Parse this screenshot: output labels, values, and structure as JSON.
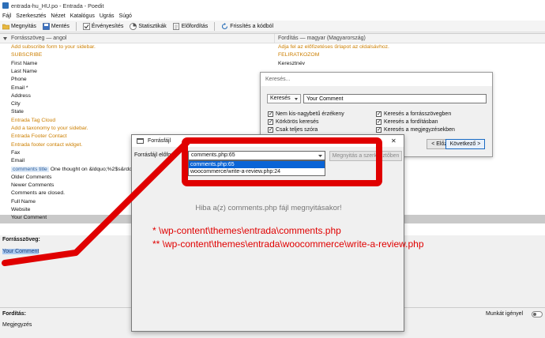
{
  "window": {
    "title": "entrada-hu_HU.po - Entrada - Poedit"
  },
  "menu": [
    "Fájl",
    "Szerkesztés",
    "Nézet",
    "Katalógus",
    "Ugrás",
    "Súgó"
  ],
  "toolbar": {
    "open": "Megnyitás",
    "save": "Mentés",
    "validate": "Érvényesítés",
    "stats": "Statisztikák",
    "pretranslate": "Előfordítás",
    "update": "Frissítés a kódból"
  },
  "columns": {
    "source": "Forrásszöveg — angol",
    "translation": "Fordítás — magyar (Magyarország)"
  },
  "rows": [
    {
      "source": "Add subscribe form to your sidebar.",
      "translation": "Adja fel az előfizetéses űrlapot az oldalsávhoz.",
      "style": "orange"
    },
    {
      "source": "SUBSCRIBE",
      "translation": "FELIRATKOZOM",
      "style": "orange"
    },
    {
      "source": "First Name",
      "translation": "Keresztnév",
      "style": ""
    },
    {
      "source": "Last Name",
      "translation": "",
      "style": ""
    },
    {
      "source": "Phone",
      "translation": "",
      "style": ""
    },
    {
      "source": "Email *",
      "translation": "",
      "style": ""
    },
    {
      "source": "Address",
      "translation": "",
      "style": ""
    },
    {
      "source": "City",
      "translation": "",
      "style": ""
    },
    {
      "source": "State",
      "translation": "",
      "style": ""
    },
    {
      "source": "Entrada Tag Cloud",
      "translation": "",
      "style": "orange"
    },
    {
      "source": "Add a taxonomy to your sidebar.",
      "translation": "",
      "style": "orange"
    },
    {
      "source": "Entrada Footer Contact",
      "translation": "",
      "style": "orange"
    },
    {
      "source": "Entrada footer contact widget.",
      "translation": "",
      "style": "orange"
    },
    {
      "source": "Fax",
      "translation": "",
      "style": ""
    },
    {
      "source": "Email",
      "translation": "",
      "style": ""
    },
    {
      "source": "One thought on &ldquo;%2$s&rdquo;",
      "tag": "comments title",
      "translation": "",
      "style": ""
    },
    {
      "source": "Older Comments",
      "translation": "",
      "style": ""
    },
    {
      "source": "Newer Comments",
      "translation": "",
      "style": ""
    },
    {
      "source": "Comments are closed.",
      "translation": "",
      "style": ""
    },
    {
      "source": "Full Name",
      "translation": "",
      "style": ""
    },
    {
      "source": "Website",
      "translation": "",
      "style": ""
    },
    {
      "source": "Your Comment",
      "translation": "",
      "style": "selected"
    }
  ],
  "source_panel": {
    "label": "Forrásszöveg:",
    "text": "Your Comment"
  },
  "translation_panel": {
    "label": "Fordítás:",
    "fuzzy": "Munkát igényel",
    "notes": "Megjegyzés"
  },
  "search_dialog": {
    "title": "Keresés...",
    "mode": "Keresés",
    "query": "Your Comment",
    "options_left": [
      "Nem kis-nagybetű érzékeny",
      "Körkörös keresés",
      "Csak teljes szóra"
    ],
    "options_right": [
      "Keresés a forrásszövegben",
      "Keresés a fordításban",
      "Keresés a megjegyzésekben"
    ],
    "prev": "< Előző",
    "next": "Következő >"
  },
  "source_dialog": {
    "title": "Forrásfájl",
    "label": "Forrásfájl előfor",
    "selected": "comments.php:65",
    "options": [
      "comments.php:65",
      "woocommerce/write-a-review.php:24"
    ],
    "open_button": "Megnyitás a szerkesztőben",
    "error": "Hiba a(z) comments.php fájl megnyitásakor!"
  },
  "annotations": [
    "* \\wp-content\\themes\\entrada\\comments.php",
    "** \\wp-content\\themes\\entrada\\woocommerce\\write-a-review.php"
  ],
  "colors": {
    "highlight": "#e00000",
    "accent": "#0a64d6",
    "orange": "#cc7f00"
  }
}
